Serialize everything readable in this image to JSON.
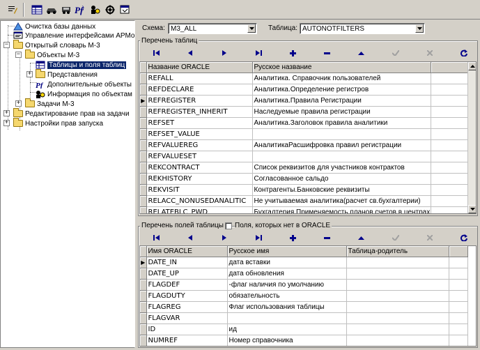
{
  "toolbar": {
    "icons": [
      "edit-icon",
      "table-icon",
      "car-icon",
      "car2-icon",
      "pf-icon",
      "search-user-icon",
      "settings-icon",
      "window-icon"
    ]
  },
  "tree": {
    "items": [
      {
        "label": "Очистка базы данных",
        "icon": "erase-icon"
      },
      {
        "label": "Управление интерфейсами АРМов",
        "icon": "interface-icon"
      },
      {
        "label": "Открытый словарь М-3",
        "icon": "folder-icon"
      },
      {
        "label": "Объекты М-3",
        "icon": "folder-icon"
      },
      {
        "label": "Таблицы и поля таблиц",
        "icon": "grid-icon"
      },
      {
        "label": "Представления",
        "icon": "folder-icon"
      },
      {
        "label": "Дополнительные объекты",
        "icon": "pf-icon"
      },
      {
        "label": "Информация по объектам",
        "icon": "info-icon"
      },
      {
        "label": "Задачи М-3",
        "icon": "folder-icon"
      },
      {
        "label": "Редактирование прав на задачи",
        "icon": "folder-icon"
      },
      {
        "label": "Настройки прав запуска",
        "icon": "folder-icon"
      }
    ]
  },
  "filters": {
    "schema_label": "Схема:",
    "schema_value": "M3_ALL",
    "table_label": "Таблица:",
    "table_value": "AUTONOTFILTERS"
  },
  "tables_group": {
    "title": "Перечень таблиц",
    "columns": [
      "Название ORACLE",
      "Русское название"
    ],
    "rows": [
      [
        "REFALL",
        "Аналитика. Справочник пользователей"
      ],
      [
        "REFDECLARE",
        "Аналитика.Определение регистров"
      ],
      [
        "REFREGISTER",
        "Аналитика.Правила Регистрации"
      ],
      [
        "REFREGISTER_INHERIT",
        "Наследуемые правила регистрации"
      ],
      [
        "REFSET",
        "Аналитика.Заголовок правила аналитики"
      ],
      [
        "REFSET_VALUE",
        ""
      ],
      [
        "REFVALUEREG",
        "АналитикаРасшифровка правил регистрации"
      ],
      [
        "REFVALUESET",
        ""
      ],
      [
        "REKCONTRACT",
        "Список реквизитов для участников контрактов"
      ],
      [
        "REKHISTORY",
        "Согласованное сальдо"
      ],
      [
        "REKVISIT",
        "Контрагенты.Банковские реквизиты"
      ],
      [
        "RELACC_NONUSEDANALITIC",
        "Не учитываемая аналитика(расчет св.бухгалтерии)"
      ],
      [
        "RELATEBLC_PWD",
        "Бухгалтерия.Применяемость планов счетов в центрах"
      ]
    ]
  },
  "fields_group": {
    "title": "Перечень полей таблицы",
    "checkbox_label": "Поля, которых нет в ORACLE",
    "columns": [
      "Имя ORACLE",
      "Русское имя",
      "Таблица-родитель"
    ],
    "rows": [
      [
        "DATE_IN",
        "дата вставки",
        ""
      ],
      [
        "DATE_UP",
        "дата обновления",
        ""
      ],
      [
        "FLAGDEF",
        "-флаг наличия по умолчанию",
        ""
      ],
      [
        "FLAGDUTY",
        "обязательность",
        ""
      ],
      [
        "FLAGREG",
        "Флаг использования таблицы",
        ""
      ],
      [
        "FLAGVAR",
        "",
        ""
      ],
      [
        "ID",
        "ид",
        ""
      ],
      [
        "NUMREF",
        "Номер справочника",
        ""
      ]
    ]
  },
  "navigator": {
    "buttons": [
      {
        "name": "first",
        "glyph": "|◄"
      },
      {
        "name": "prior",
        "glyph": "◄"
      },
      {
        "name": "next",
        "glyph": "►"
      },
      {
        "name": "last",
        "glyph": "►|"
      },
      {
        "name": "insert",
        "glyph": "+"
      },
      {
        "name": "delete",
        "glyph": "−"
      },
      {
        "name": "edit",
        "glyph": "▲"
      },
      {
        "name": "post",
        "glyph": "✓"
      },
      {
        "name": "cancel",
        "glyph": "✕"
      },
      {
        "name": "refresh",
        "glyph": "↻"
      }
    ]
  },
  "colors": {
    "selection": "#0a246a",
    "nav_active": "#00008b",
    "nav_disabled": "#a0a0a0"
  }
}
